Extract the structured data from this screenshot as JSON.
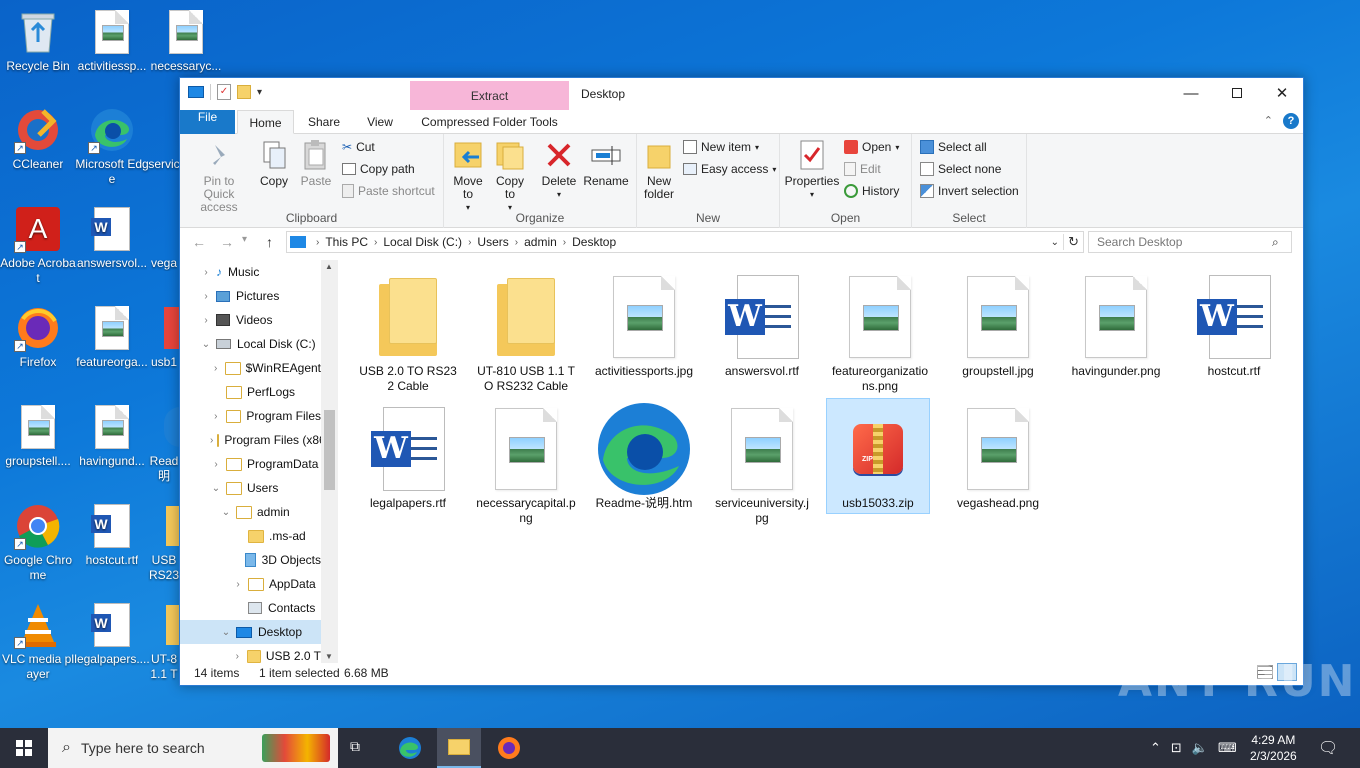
{
  "desktop": {
    "icons": [
      {
        "label": "Recycle Bin"
      },
      {
        "label": "activitiessp..."
      },
      {
        "label": "necessaryc..."
      },
      {
        "label": "CCleaner"
      },
      {
        "label": "Microsoft Edge"
      },
      {
        "label": "servic"
      },
      {
        "label": "Adobe Acrobat"
      },
      {
        "label": "answersvol..."
      },
      {
        "label": "vega"
      },
      {
        "label": "Firefox"
      },
      {
        "label": "featureorga..."
      },
      {
        "label": "usb1"
      },
      {
        "label": "groupstell...."
      },
      {
        "label": "havingund..."
      },
      {
        "label": "Read 明"
      },
      {
        "label": "Google Chrome"
      },
      {
        "label": "hostcut.rtf"
      },
      {
        "label": "USB RS23"
      },
      {
        "label": "VLC media player"
      },
      {
        "label": "legalpapers...."
      },
      {
        "label": "UT-8 1.1 T"
      }
    ]
  },
  "window": {
    "title": "Desktop",
    "context_tab_group": "Extract",
    "tabs": {
      "file": "File",
      "home": "Home",
      "share": "Share",
      "view": "View",
      "compressed": "Compressed Folder Tools"
    },
    "ribbon": {
      "clipboard": {
        "pin": "Pin to Quick access",
        "copy": "Copy",
        "paste": "Paste",
        "cut": "Cut",
        "copy_path": "Copy path",
        "paste_shortcut": "Paste shortcut",
        "label": "Clipboard"
      },
      "organize": {
        "move_to": "Move to",
        "copy_to": "Copy to",
        "delete": "Delete",
        "rename": "Rename",
        "label": "Organize"
      },
      "new": {
        "new_folder": "New folder",
        "new_item": "New item",
        "easy_access": "Easy access",
        "label": "New"
      },
      "open": {
        "properties": "Properties",
        "open": "Open",
        "edit": "Edit",
        "history": "History",
        "label": "Open"
      },
      "select": {
        "select_all": "Select all",
        "select_none": "Select none",
        "invert": "Invert selection",
        "label": "Select"
      }
    },
    "address": {
      "path": [
        "This PC",
        "Local Disk (C:)",
        "Users",
        "admin",
        "Desktop"
      ]
    },
    "search": {
      "placeholder": "Search Desktop"
    },
    "nav": [
      {
        "label": "Music"
      },
      {
        "label": "Pictures"
      },
      {
        "label": "Videos"
      },
      {
        "label": "Local Disk (C:)"
      },
      {
        "label": "$WinREAgent"
      },
      {
        "label": "PerfLogs"
      },
      {
        "label": "Program Files"
      },
      {
        "label": "Program Files (x86)"
      },
      {
        "label": "ProgramData"
      },
      {
        "label": "Users"
      },
      {
        "label": "admin"
      },
      {
        "label": ".ms-ad"
      },
      {
        "label": "3D Objects"
      },
      {
        "label": "AppData"
      },
      {
        "label": "Contacts"
      },
      {
        "label": "Desktop"
      },
      {
        "label": "USB 2.0 T"
      }
    ],
    "files": [
      {
        "name": "USB 2.0 TO RS232 Cable",
        "type": "folder"
      },
      {
        "name": "UT-810 USB 1.1 TO RS232 Cable",
        "type": "folder"
      },
      {
        "name": "activitiessports.jpg",
        "type": "image"
      },
      {
        "name": "answersvol.rtf",
        "type": "word"
      },
      {
        "name": "featureorganizations.png",
        "type": "image"
      },
      {
        "name": "groupstell.jpg",
        "type": "image"
      },
      {
        "name": "havingunder.png",
        "type": "image"
      },
      {
        "name": "hostcut.rtf",
        "type": "word"
      },
      {
        "name": "legalpapers.rtf",
        "type": "word"
      },
      {
        "name": "necessarycapital.png",
        "type": "image"
      },
      {
        "name": "Readme-说明.htm",
        "type": "edge"
      },
      {
        "name": "serviceuniversity.jpg",
        "type": "image"
      },
      {
        "name": "usb15033.zip",
        "type": "zip",
        "selected": true
      },
      {
        "name": "vegashead.png",
        "type": "image"
      }
    ],
    "status": {
      "count": "14 items",
      "selection": "1 item selected",
      "size": "6.68 MB"
    }
  },
  "taskbar": {
    "search_placeholder": "Type here to search",
    "time": "4:29 AM",
    "date": "2/3/2026"
  },
  "watermark": "ANY RUN"
}
